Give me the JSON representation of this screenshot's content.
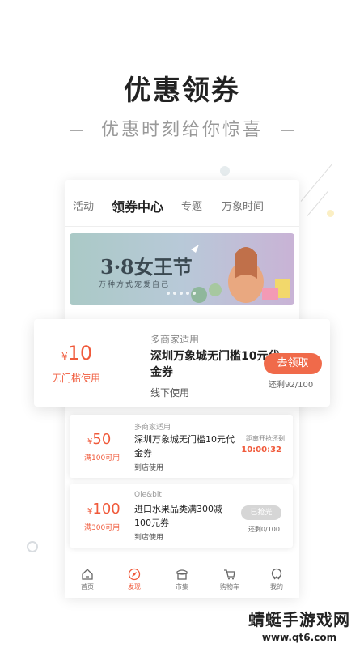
{
  "hero": {
    "title": "优惠领券",
    "subtitle": "优惠时刻给你惊喜"
  },
  "tabs": [
    {
      "label": "活动",
      "active": false
    },
    {
      "label": "领券中心",
      "active": true
    },
    {
      "label": "专题",
      "active": false
    },
    {
      "label": "万象时间",
      "active": false
    }
  ],
  "banner": {
    "title": "3·8女王节",
    "subtitle": "万种方式宠爱自己"
  },
  "featured_coupon": {
    "currency": "¥",
    "amount": "10",
    "condition": "无门槛使用",
    "merchant": "多商家适用",
    "name": "深圳万象城无门槛10元代金券",
    "usage": "线下使用",
    "button": "去领取",
    "remaining": "还剩92/100"
  },
  "coupons": [
    {
      "currency": "¥",
      "amount": "50",
      "condition": "满100可用",
      "merchant": "多商家适用",
      "name": "深圳万象城无门槛10元代金券",
      "usage": "到店使用",
      "right_label": "距离开抢还剩",
      "countdown": "10:00:32"
    },
    {
      "currency": "¥",
      "amount": "100",
      "condition": "满300可用",
      "merchant": "Ole&bit",
      "name": "进口水果品类满300减100元券",
      "usage": "到店使用",
      "button": "已抢光",
      "remaining": "还剩0/100"
    }
  ],
  "bottom_nav": [
    {
      "label": "首页",
      "icon": "home-icon",
      "active": false
    },
    {
      "label": "发现",
      "icon": "compass-icon",
      "active": true
    },
    {
      "label": "市集",
      "icon": "store-icon",
      "active": false
    },
    {
      "label": "购物车",
      "icon": "cart-icon",
      "active": false
    },
    {
      "label": "我的",
      "icon": "user-icon",
      "active": false
    }
  ],
  "watermark": {
    "line1": "蜻蜓手游戏网",
    "line2": "www.qt6.com"
  },
  "colors": {
    "accent": "#f05a3b",
    "button": "#f06a4a",
    "disabled": "#d6d6d6"
  }
}
